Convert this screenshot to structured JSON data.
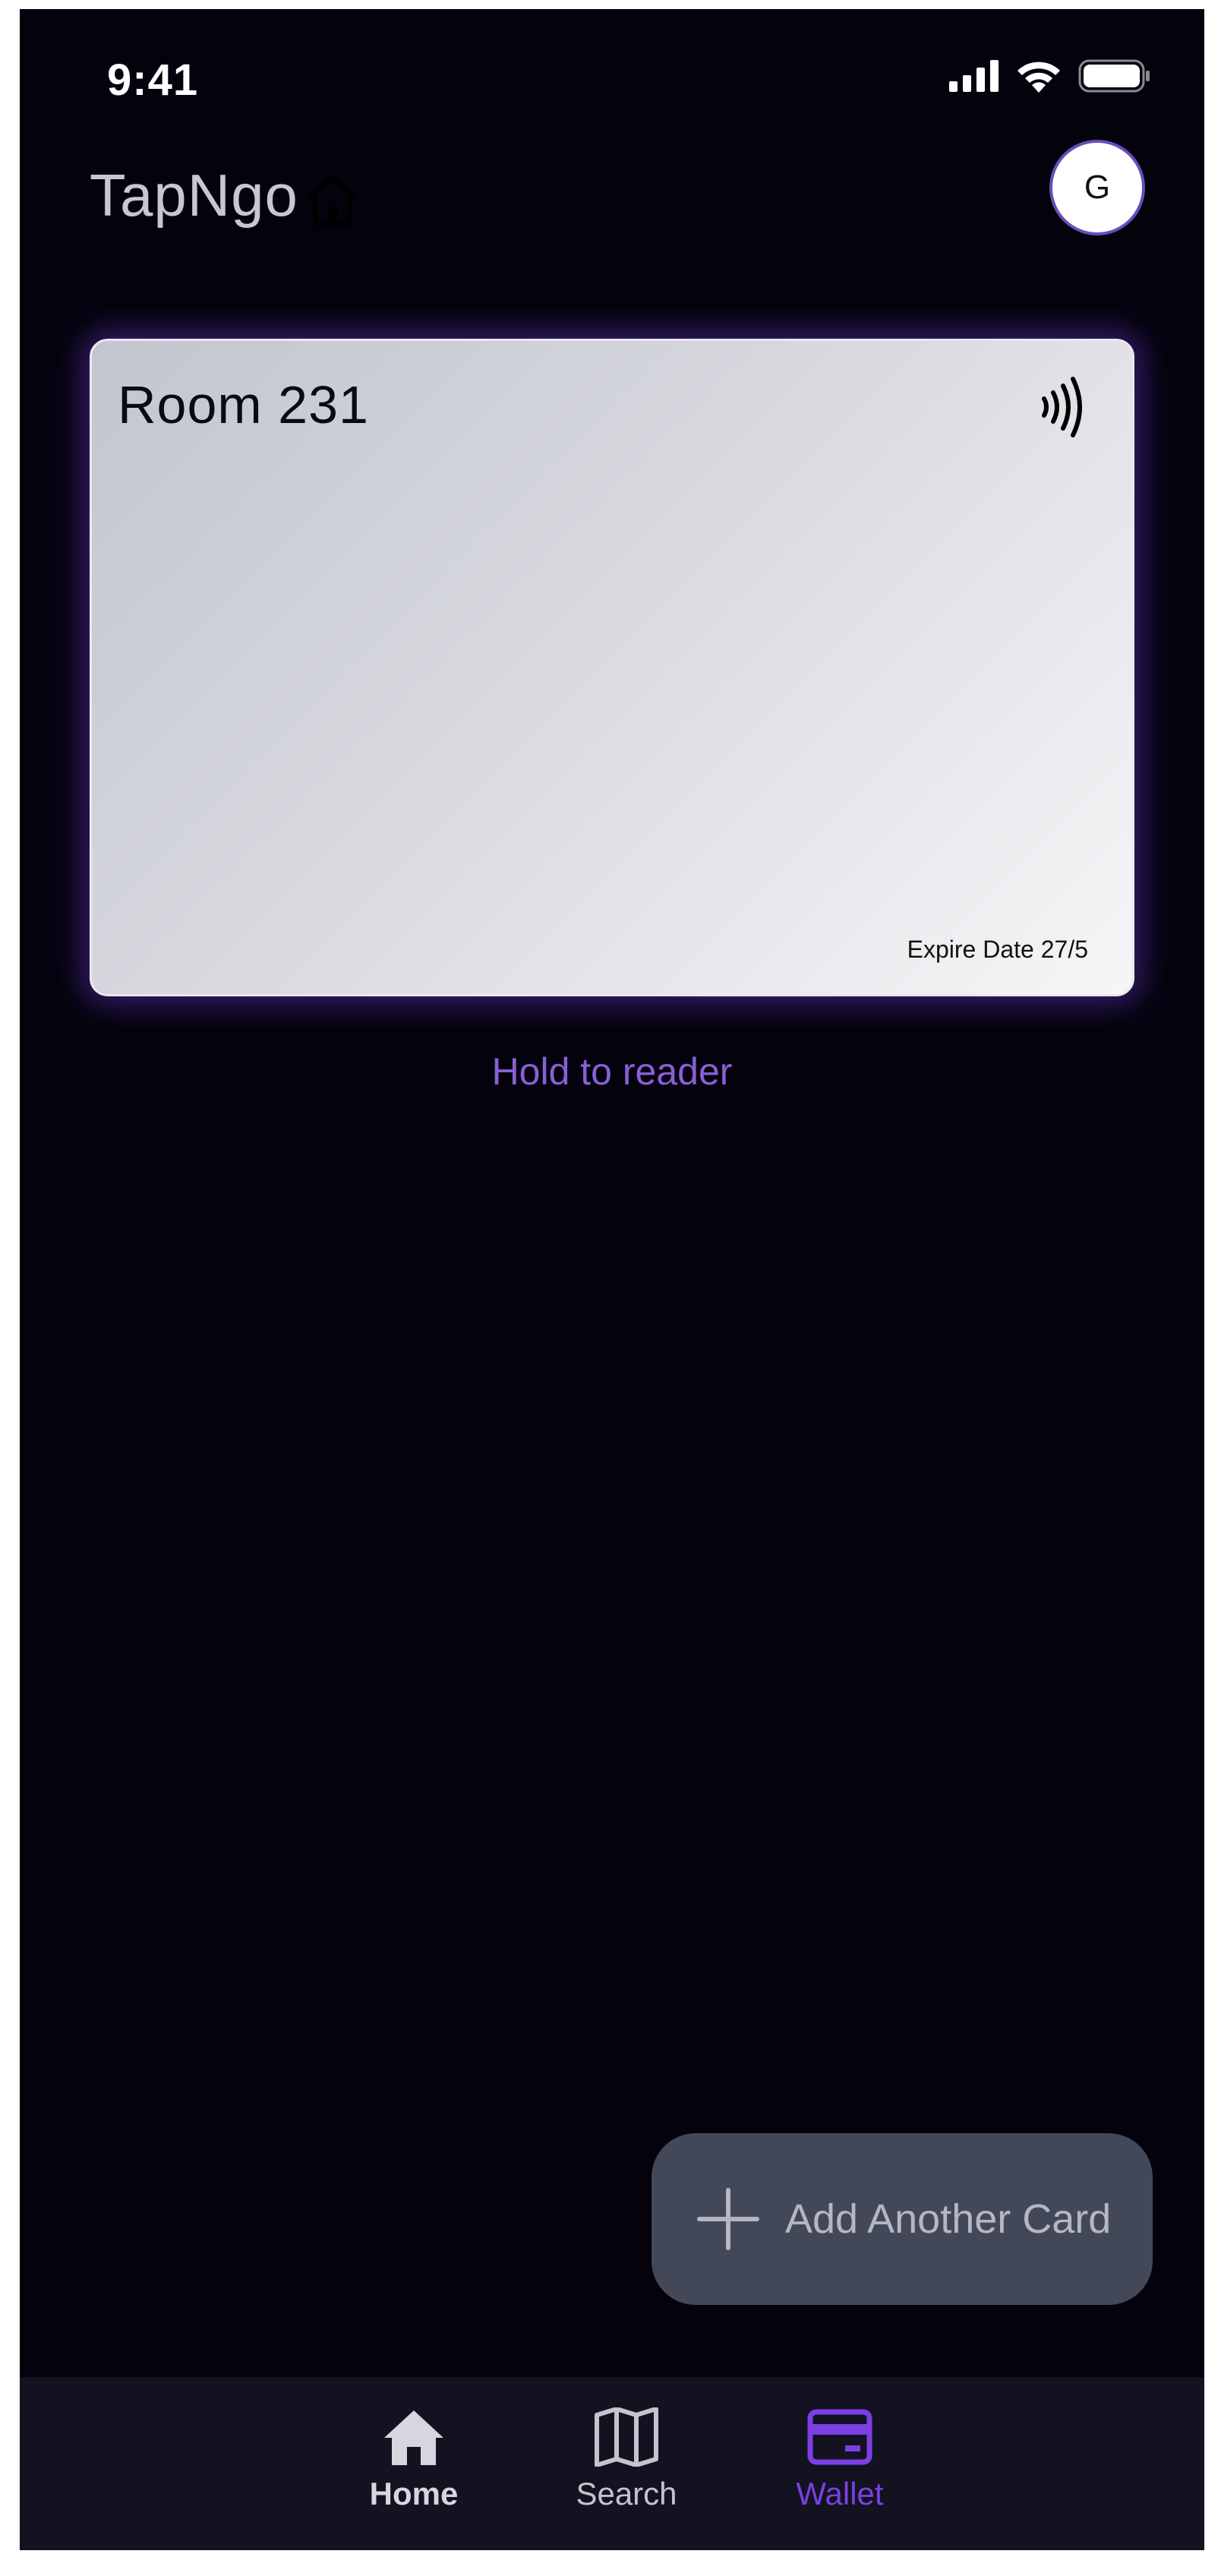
{
  "status_bar": {
    "time": "9:41",
    "icons": [
      "signal-icon",
      "wifi-icon",
      "battery-icon"
    ]
  },
  "header": {
    "app_title": "TapNgo",
    "title_icon": "home-icon",
    "avatar_initial": "G"
  },
  "card": {
    "title": "Room 231",
    "icon": "nfc-contactless-icon",
    "expiry": "Expire Date 27/5"
  },
  "hint": "Hold to reader",
  "add_card_button": {
    "label": "Add Another Card",
    "icon": "plus-icon"
  },
  "bottom_nav": {
    "items": [
      {
        "label": "Home",
        "icon": "home-icon",
        "state": "bold"
      },
      {
        "label": "Search",
        "icon": "map-icon",
        "state": "normal"
      },
      {
        "label": "Wallet",
        "icon": "wallet-card-icon",
        "state": "active"
      }
    ]
  },
  "colors": {
    "background": "#04030d",
    "accent": "#7b3fe4",
    "hint_text": "#8a5fd6",
    "nav_background": "#121221",
    "button_background": "#434859"
  }
}
